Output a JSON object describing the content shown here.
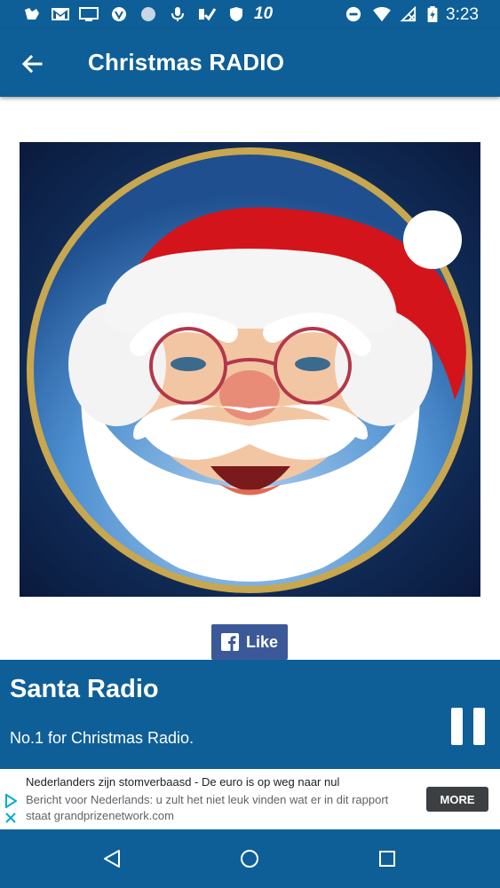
{
  "status_bar": {
    "clock": "3:23",
    "badge": "10"
  },
  "app_bar": {
    "title": "Christmas RADIO"
  },
  "like_button": {
    "label": "Like"
  },
  "player": {
    "station_name": "Santa Radio",
    "slogan": "No.1 for Christmas Radio."
  },
  "ad": {
    "headline": "Nederlanders zijn stomverbaasd - De euro is op weg naar nul",
    "body": "Bericht voor Nederlands: u zult het niet leuk vinden wat er in dit rapport",
    "source": "staat grandprizenetwork.com",
    "cta": "MORE"
  },
  "colors": {
    "primary": "#0e5f97",
    "facebook": "#3b5998"
  }
}
